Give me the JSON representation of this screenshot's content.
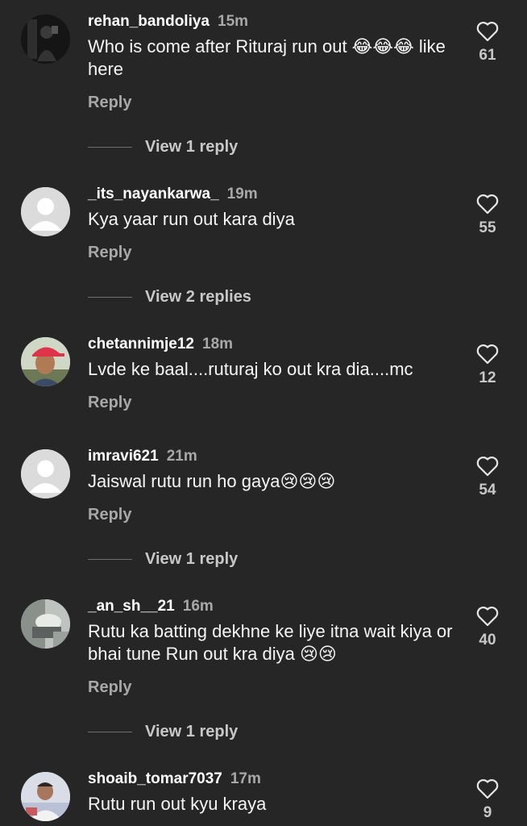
{
  "comments": [
    {
      "username": "rehan_bandoliya",
      "time": "15m",
      "text": "Who is come after Rituraj run out 😂😂😂 like here",
      "reply_label": "Reply",
      "likes": "61",
      "view_replies": "View 1 reply",
      "avatar": "dark-photo"
    },
    {
      "username": "_its_nayankarwa_",
      "time": "19m",
      "text": "Kya yaar run out kara diya",
      "reply_label": "Reply",
      "likes": "55",
      "view_replies": "View 2 replies",
      "avatar": "default"
    },
    {
      "username": "chetannimje12",
      "time": "18m",
      "text": "Lvde ke baal....ruturaj ko out kra dia....mc",
      "reply_label": "Reply",
      "likes": "12",
      "view_replies": "",
      "avatar": "person-red-cap"
    },
    {
      "username": "imravi621",
      "time": "21m",
      "text": "Jaiswal rutu run ho gaya😢😢😢",
      "reply_label": "Reply",
      "likes": "54",
      "view_replies": "View 1 reply",
      "avatar": "default"
    },
    {
      "username": "_an_sh__21",
      "time": "16m",
      "text": "Rutu ka batting dekhne ke liye itna wait kiya or bhai tune Run out kra diya 😢😢",
      "reply_label": "Reply",
      "likes": "40",
      "view_replies": "View 1 reply",
      "avatar": "blurry-photo"
    },
    {
      "username": "shoaib_tomar7037",
      "time": "17m",
      "text": "Rutu run out kyu kraya",
      "reply_label": "",
      "likes": "9",
      "view_replies": "",
      "avatar": "person-photo"
    }
  ],
  "colors": {
    "background": "#262626",
    "username": "#ffffff",
    "secondary": "#a8a8a8"
  }
}
